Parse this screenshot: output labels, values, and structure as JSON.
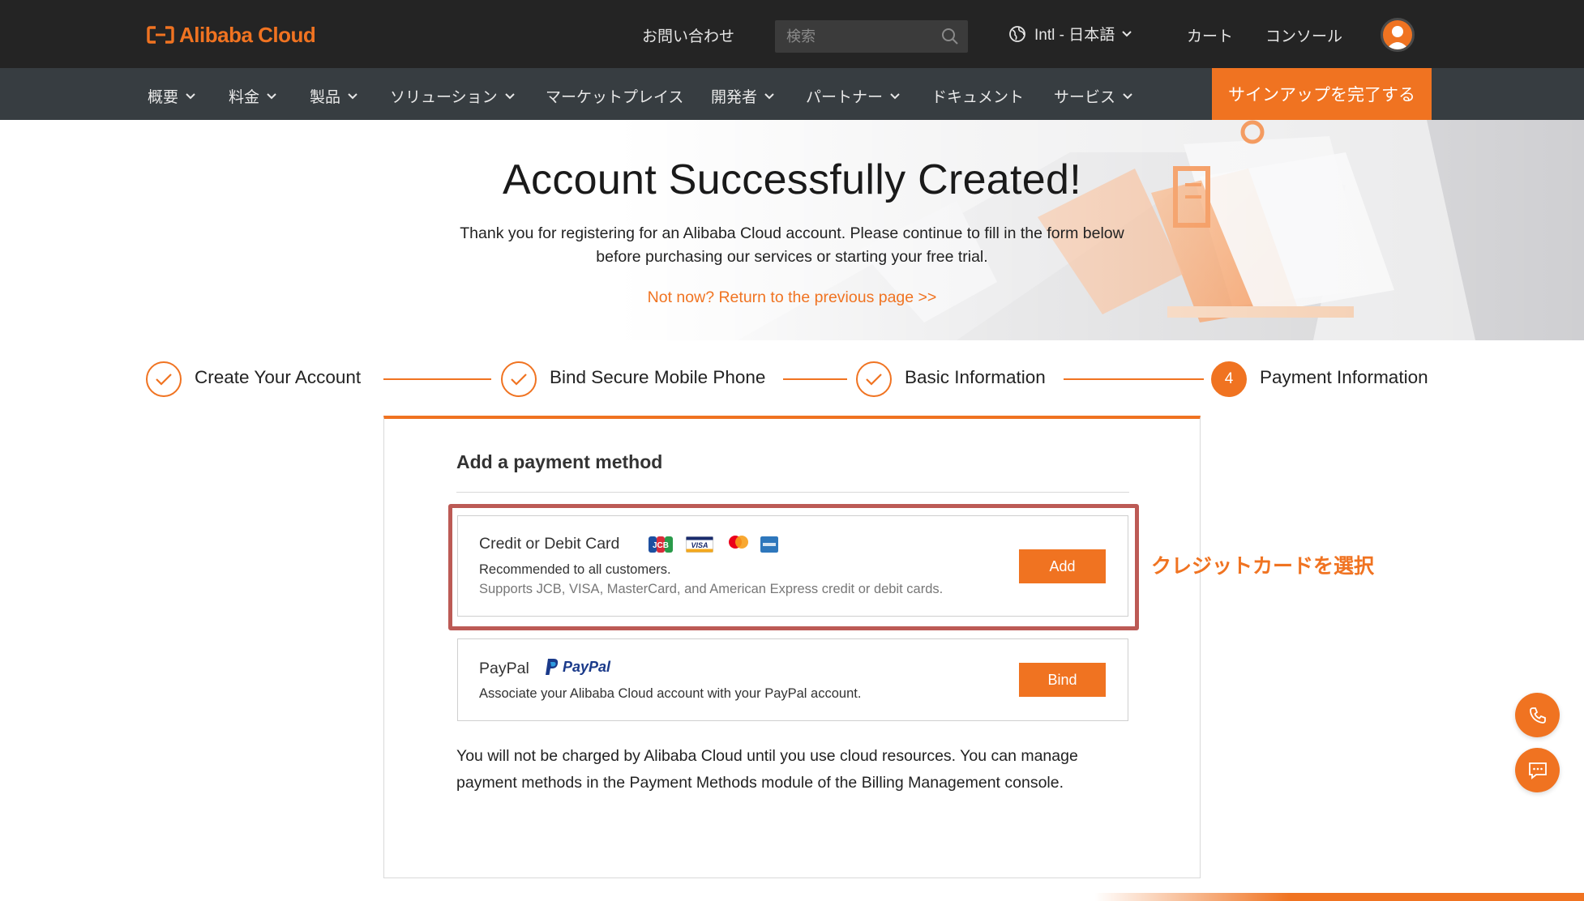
{
  "colors": {
    "accent": "#f07321",
    "topbar": "#242424",
    "navbar": "#373d41",
    "highlight_border": "#bc5a55"
  },
  "header": {
    "logo_text": "Alibaba Cloud",
    "contact": "お問い合わせ",
    "search_placeholder": "検索",
    "language": "Intl - 日本語",
    "cart": "カート",
    "console": "コンソール"
  },
  "nav": {
    "items": [
      {
        "label": "概要",
        "dropdown": true
      },
      {
        "label": "料金",
        "dropdown": true
      },
      {
        "label": "製品",
        "dropdown": true
      },
      {
        "label": "ソリューション",
        "dropdown": true
      },
      {
        "label": "マーケットプレイス",
        "dropdown": false
      },
      {
        "label": "開発者",
        "dropdown": true
      },
      {
        "label": "パートナー",
        "dropdown": true
      },
      {
        "label": "ドキュメント",
        "dropdown": false
      },
      {
        "label": "サービス",
        "dropdown": true
      }
    ],
    "signup_button": "サインアップを完了する"
  },
  "hero": {
    "title": "Account Successfully Created!",
    "description_line1": "Thank you for registering for an Alibaba Cloud account. Please continue to fill in the form below",
    "description_line2": "before purchasing our services or starting your free trial.",
    "back_link": "Not now? Return to the previous page >>"
  },
  "steps": [
    {
      "label": "Create Your Account",
      "status": "done"
    },
    {
      "label": "Bind Secure Mobile Phone",
      "status": "done"
    },
    {
      "label": "Basic Information",
      "status": "done"
    },
    {
      "label": "Payment Information",
      "status": "current",
      "number": "4"
    }
  ],
  "payment": {
    "title": "Add a payment method",
    "card": {
      "name": "Credit or Debit Card",
      "brands": [
        "JCB",
        "VISA",
        "MasterCard",
        "American Express"
      ],
      "line1": "Recommended to all customers.",
      "line2": "Supports JCB, VISA, MasterCard, and American Express credit or debit cards.",
      "button": "Add"
    },
    "paypal": {
      "name": "PayPal",
      "logo_text": "PayPal",
      "line1": "Associate your Alibaba Cloud account with your PayPal account.",
      "button": "Bind"
    },
    "note": "You will not be charged by Alibaba Cloud until you use cloud resources. You can manage payment methods in the Payment Methods module of the Billing Management console."
  },
  "annotation": "クレジットカードを選択",
  "floating": {
    "phone_icon": "phone-icon",
    "chat_icon": "chat-icon"
  }
}
